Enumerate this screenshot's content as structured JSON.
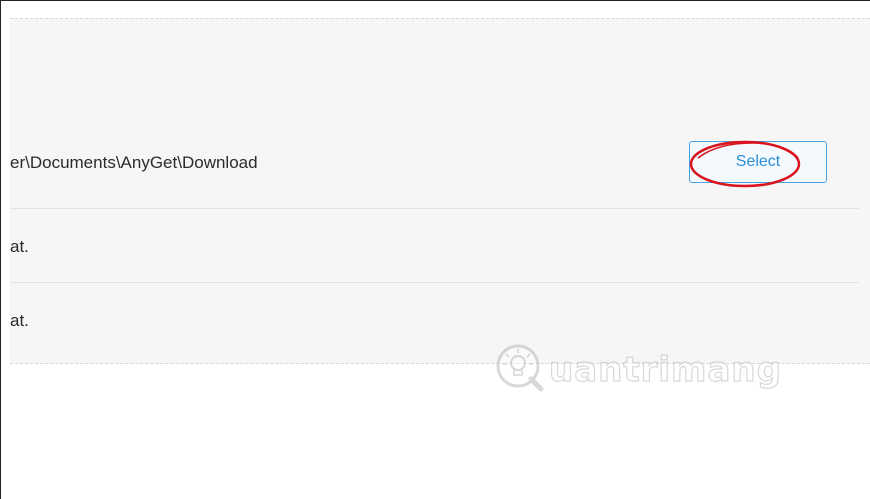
{
  "settings": {
    "download_path": "er\\Documents\\AnyGet\\Download",
    "select_label": "Select",
    "row2_text": "at.",
    "row3_text": "at."
  },
  "watermark": {
    "text": "uantrimang",
    "icon": "lightbulb-q-logo"
  },
  "colors": {
    "accent": "#2a8fd6",
    "highlight_ring": "#d9141c",
    "panel_background": "#f6f6f6"
  }
}
